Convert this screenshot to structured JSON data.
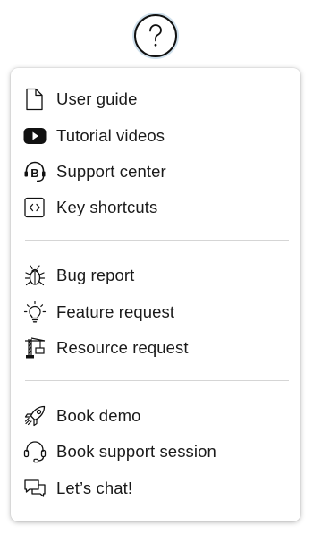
{
  "trigger": {
    "symbol": "?",
    "icon": "question-mark-icon"
  },
  "menu": {
    "groups": [
      {
        "items": [
          {
            "label": "User guide",
            "icon": "document-icon"
          },
          {
            "label": "Tutorial videos",
            "icon": "play-video-icon"
          },
          {
            "label": "Support center",
            "icon": "support-center-icon"
          },
          {
            "label": "Key shortcuts",
            "icon": "code-brackets-icon"
          }
        ]
      },
      {
        "items": [
          {
            "label": "Bug report",
            "icon": "bug-icon"
          },
          {
            "label": "Feature request",
            "icon": "lightbulb-icon"
          },
          {
            "label": "Resource request",
            "icon": "crane-icon"
          }
        ]
      },
      {
        "items": [
          {
            "label": "Book demo",
            "icon": "rocket-icon"
          },
          {
            "label": "Book support session",
            "icon": "headset-icon"
          },
          {
            "label": "Let’s chat!",
            "icon": "chat-bubbles-icon"
          }
        ]
      }
    ]
  },
  "colors": {
    "trigger_ring": "#cfe0ec",
    "text": "#1a1a1a",
    "divider": "#d5d5d5"
  }
}
